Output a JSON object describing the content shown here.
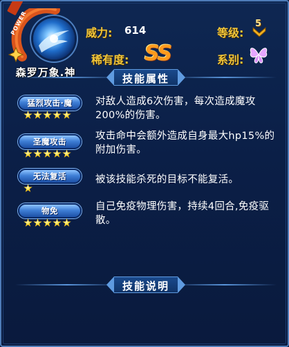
{
  "skill": {
    "name": "森罗万象.神",
    "power_tag": "POWER",
    "power_label": "威力:",
    "power_value": "614",
    "level_label": "等级:",
    "level_value": "5",
    "rarity_label": "稀有度:",
    "rarity_value": "SS",
    "element_label": "系别:",
    "element_icon": "butterfly-icon"
  },
  "sections": {
    "attributes_title": "技能属性",
    "description_title": "技能说明"
  },
  "effects": [
    {
      "label": "猛烈攻击·魔",
      "stars": 5,
      "text": "对敌人造成6次伤害，每次造成魔攻200%的伤害。"
    },
    {
      "label": "圣魔攻击",
      "stars": 5,
      "text": "攻击命中会额外造成自身最大hp15%的附加伤害。"
    },
    {
      "label": "无法复活",
      "stars": 1,
      "text": "被该技能杀死的目标不能复活。"
    },
    {
      "label": "物免",
      "stars": 5,
      "text": "自己免疫物理伤害，持续4回合,免疫驱散。"
    }
  ],
  "colors": {
    "accent_gold": "#f0c53a",
    "rarity_orange": "#ff9a1c",
    "panel_bg": "#0e2752",
    "border_blue": "#4e7cb8",
    "tag_blue": "#3f7fd6"
  }
}
